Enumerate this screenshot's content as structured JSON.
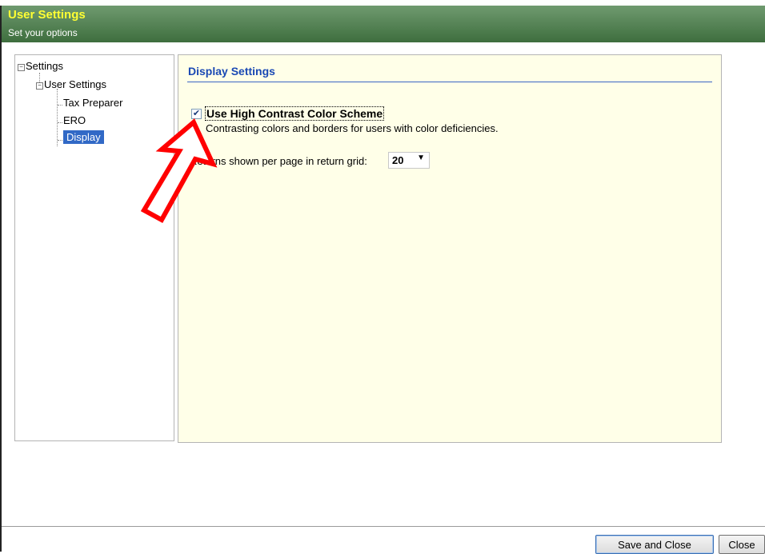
{
  "window": {
    "title": "User Settings",
    "subtitle": "Set your options"
  },
  "tree": {
    "root": "Settings",
    "group": "User Settings",
    "items": [
      "Tax Preparer",
      "ERO",
      "Display"
    ],
    "selected": "Display"
  },
  "display_settings": {
    "heading": "Display Settings",
    "high_contrast": {
      "label": "Use High Contrast Color Scheme",
      "checked": true,
      "description": "Contrasting colors and borders for users with color deficiencies."
    },
    "returns_per_page": {
      "label": "Returns shown per page in return grid:",
      "value": "20"
    }
  },
  "buttons": {
    "save_and_close": "Save and Close",
    "close": "Close"
  },
  "colors": {
    "titlebar": "#4f7f4f",
    "title_text": "#ffff33",
    "heading": "#1a49b4",
    "selection": "#3169c6",
    "content_bg": "#ffffe8",
    "annotation": "#ff0000"
  },
  "icons": [
    "tree-collapse-icon",
    "checkmark-icon",
    "dropdown-arrow-icon",
    "annotation-arrow-icon"
  ]
}
